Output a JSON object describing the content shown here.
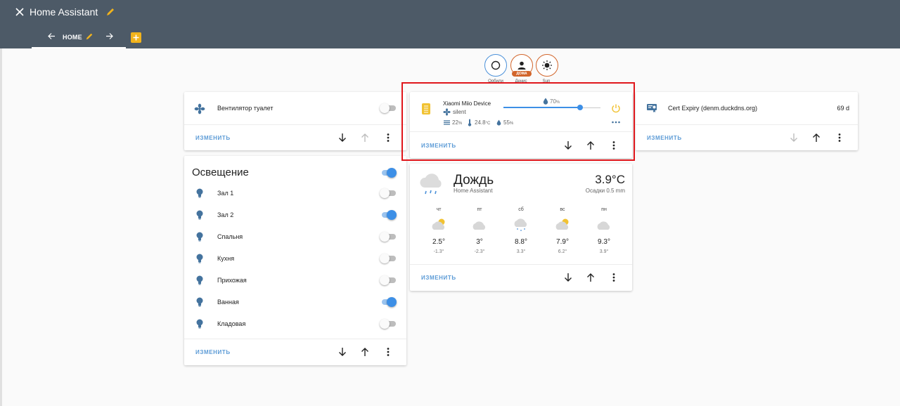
{
  "header": {
    "title": "Home Assistant",
    "view_tab": "HOME"
  },
  "badges": [
    {
      "label": "Орбили",
      "icon": "circle-icon",
      "color": "#4a90d9"
    },
    {
      "label": "Денис",
      "icon": "person-icon",
      "tag": "ДОМА",
      "color": "#d2652b"
    },
    {
      "label": "Sun",
      "icon": "sun-icon",
      "color": "#d2652b"
    }
  ],
  "edit_label": "ИЗМЕНИТЬ",
  "fan_card": {
    "name": "Вентилятор туалет",
    "state": "off"
  },
  "lights_card": {
    "title": "Освещение",
    "master_state": "on",
    "items": [
      {
        "name": "Зал 1",
        "state": "off"
      },
      {
        "name": "Зал 2",
        "state": "on"
      },
      {
        "name": "Спальня",
        "state": "off"
      },
      {
        "name": "Кухня",
        "state": "off"
      },
      {
        "name": "Прихожая",
        "state": "off"
      },
      {
        "name": "Ванная",
        "state": "on"
      },
      {
        "name": "Кладовая",
        "state": "off"
      }
    ]
  },
  "purifier_card": {
    "name": "Xiaomi Miio Device",
    "mode": "silent",
    "target_humidity": "70",
    "target_humidity_unit": "%",
    "slider_fraction": 0.79,
    "stat1_value": "22",
    "stat1_unit": "%",
    "temperature": "24.8",
    "temperature_unit": "°C",
    "humidity": "55",
    "humidity_unit": "%"
  },
  "weather_card": {
    "condition": "Дождь",
    "source": "Home Assistant",
    "temperature": "3.9°C",
    "precipitation": "Осадки 0.5 mm",
    "forecast": [
      {
        "day": "чт",
        "icon": "partly-cloudy-icon",
        "high": "2.5°",
        "low": "-1.3°"
      },
      {
        "day": "пт",
        "icon": "cloudy-icon",
        "high": "3°",
        "low": "-2.3°"
      },
      {
        "day": "сб",
        "icon": "snowy-icon",
        "high": "8.8°",
        "low": "3.3°"
      },
      {
        "day": "вс",
        "icon": "partly-cloudy-icon",
        "high": "7.9°",
        "low": "6.2°"
      },
      {
        "day": "пн",
        "icon": "cloudy-icon",
        "high": "9.3°",
        "low": "3.9°"
      }
    ]
  },
  "cert_card": {
    "name": "Cert Expiry (denm.duckdns.org)",
    "value": "69 d"
  },
  "colors": {
    "header_bg": "#4d5a67",
    "accent": "#f1b31c",
    "toggle_on": "#3d8fe6",
    "edit_link": "#5c9bd6",
    "icon": "#44739e",
    "highlight": "#e0161b"
  }
}
